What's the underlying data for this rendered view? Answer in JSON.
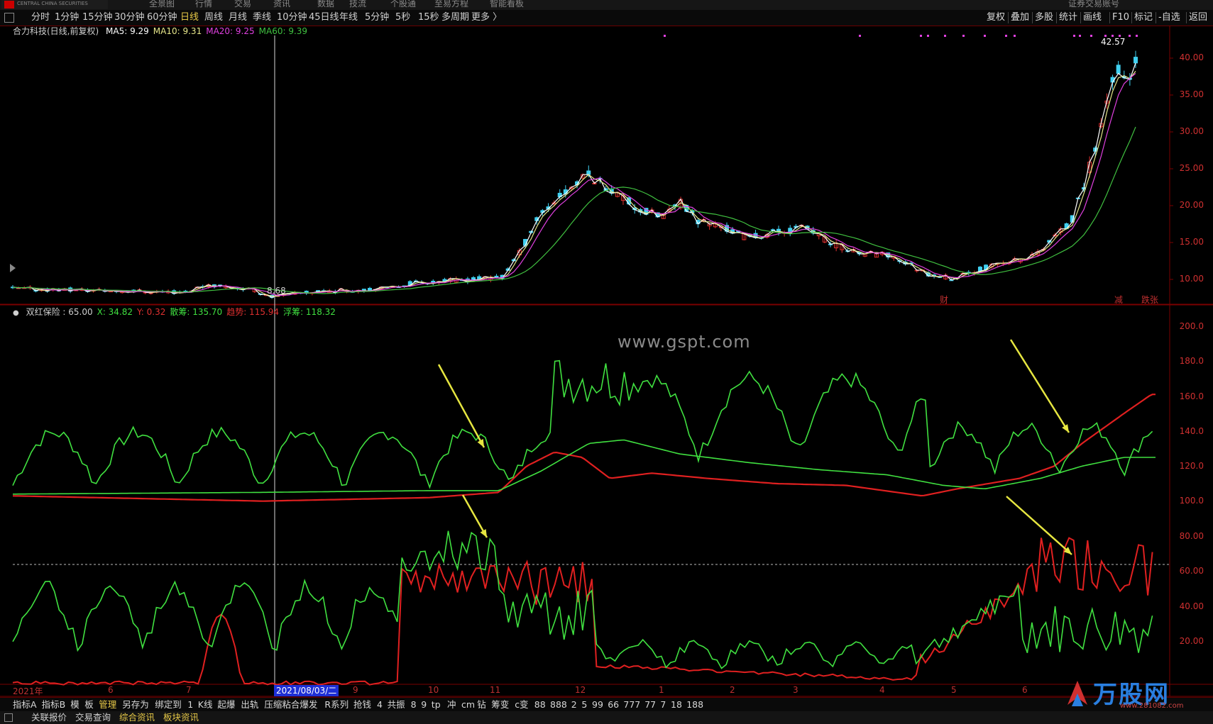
{
  "top_menu": [
    "全景图",
    "行情",
    "交易",
    "资讯",
    "数据",
    "技流",
    "个股通",
    "至易方程",
    "智能看板"
  ],
  "top_right": "证券交易账号",
  "period_tabs": [
    "分时",
    "1分钟",
    "15分钟",
    "30分钟",
    "60分钟",
    "日线",
    "周线",
    "月线",
    "季线",
    "10分钟",
    "45日线",
    "年线",
    "5分钟",
    "5秒",
    "15秒",
    "多周期",
    "更多 〉"
  ],
  "active_period": "日线",
  "right_tools": [
    "复权",
    "叠加",
    "多股",
    "统计",
    "画线",
    "F10",
    "标记",
    "-自选",
    "返回"
  ],
  "stock_title": "合力科技(日线,前复权)",
  "ma_legend": [
    {
      "label": "MA5: 9.29",
      "color": "#ffffff"
    },
    {
      "label": "MA10: 9.31",
      "color": "#e6e68a"
    },
    {
      "label": "MA20: 9.25",
      "color": "#e040e0"
    },
    {
      "label": "MA60: 9.39",
      "color": "#40c040"
    }
  ],
  "price_axis": [
    "40.00",
    "35.00",
    "30.00",
    "25.00",
    "20.00",
    "15.00",
    "10.00"
  ],
  "price_high_label": "42.57",
  "price_low_label": "8.68",
  "event_markers": [
    "财",
    "减",
    "跌张"
  ],
  "indicator_legend": [
    {
      "label": "双红保险 : 65.00",
      "color": "#cfcfcf"
    },
    {
      "label": "X: 34.82",
      "color": "#40e040"
    },
    {
      "label": "Y: 0.32",
      "color": "#e03030"
    },
    {
      "label": "散筹: 135.70",
      "color": "#40e040"
    },
    {
      "label": "趋势: 115.94",
      "color": "#e03030"
    },
    {
      "label": "浮筹: 118.32",
      "color": "#40e040"
    }
  ],
  "indicator_axis": [
    "200.0",
    "180.0",
    "160.0",
    "140.0",
    "120.0",
    "100.0",
    "80.00",
    "60.00",
    "40.00",
    "20.00"
  ],
  "x_axis": [
    "2021年",
    "6",
    "7",
    "8",
    "2021/08/03/二",
    "9",
    "10",
    "11",
    "12",
    "1",
    "2",
    "3",
    "4",
    "5",
    "6"
  ],
  "watermark": "www.gspt.com",
  "indicator_tabs": [
    "指标A",
    "指标B",
    "模",
    "板",
    "管理",
    "另存为",
    "绑定到",
    "1",
    "K线",
    "起爆",
    "出轨",
    "压缩粘合爆发",
    "R系列",
    "抢钱",
    "4",
    "共振",
    "8",
    "9",
    "tp",
    "冲",
    "cm",
    "钻",
    "筹变",
    "c变",
    "88",
    "888",
    "2",
    "5",
    "99",
    "66",
    "777",
    "77",
    "7",
    "18",
    "188"
  ],
  "active_indicator_tab": "管理",
  "status_items": [
    {
      "label": "关联报价",
      "color": "#d0d0d0"
    },
    {
      "label": "交易查询",
      "color": "#d0d0d0"
    },
    {
      "label": "综合资讯",
      "color": "#e6c847"
    },
    {
      "label": "板块资讯",
      "color": "#e6c847"
    }
  ],
  "brand_name": "万股网",
  "brand_url": "www.281082.com",
  "colors": {
    "up": "#e03030",
    "down": "#40d0f0",
    "red_line": "#e02020",
    "green_line": "#40e040",
    "arrow": "#e6e640"
  }
}
